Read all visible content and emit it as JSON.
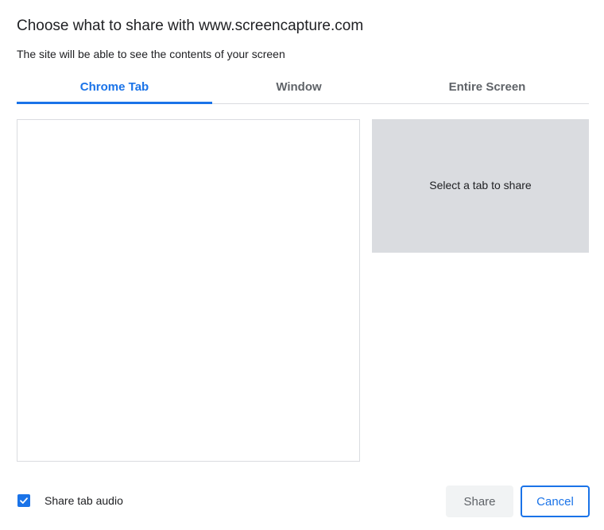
{
  "dialog": {
    "title": "Choose what to share with www.screencapture.com",
    "subtitle": "The site will be able to see the contents of your screen"
  },
  "tabs": [
    {
      "label": "Chrome Tab",
      "active": true
    },
    {
      "label": "Window",
      "active": false
    },
    {
      "label": "Entire Screen",
      "active": false
    }
  ],
  "preview": {
    "placeholder": "Select a tab to share"
  },
  "footer": {
    "share_audio_label": "Share tab audio",
    "share_audio_checked": true,
    "share_label": "Share",
    "cancel_label": "Cancel"
  },
  "icons": {
    "checkbox": "checkmark-icon"
  },
  "colors": {
    "accent": "#1a73e8",
    "preview_bg": "#dadce0",
    "share_button_bg": "#f1f3f4"
  }
}
